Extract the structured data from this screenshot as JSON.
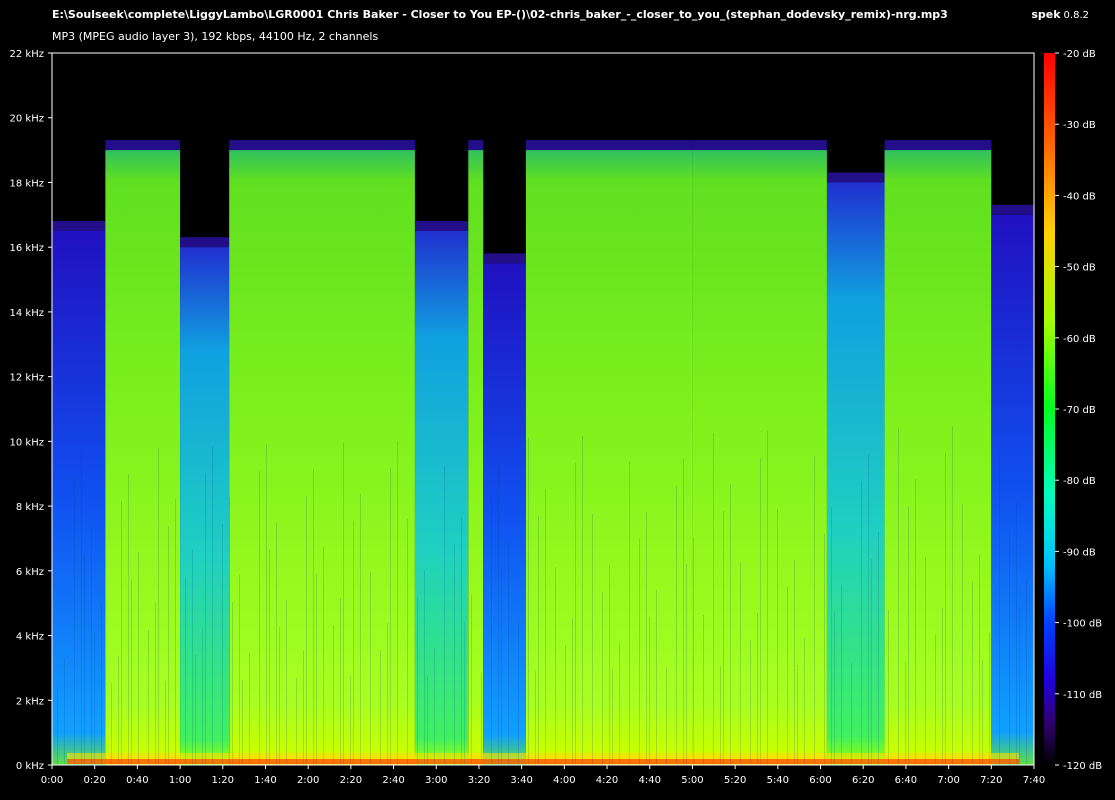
{
  "header": {
    "file_path": "E:\\Soulseek\\complete\\LiggyLambo\\LGR0001 Chris Baker - Closer to You EP-()\\02-chris_baker_-_closer_to_you_(stephan_dodevsky_remix)-nrg.mp3",
    "file_info": "MP3 (MPEG audio layer 3), 192 kbps, 44100 Hz, 2 channels",
    "app_name": "spek",
    "app_version": "0.8.2"
  },
  "frequency_axis": {
    "ticks": [
      "0 kHz",
      "2 kHz",
      "4 kHz",
      "6 kHz",
      "8 kHz",
      "10 kHz",
      "12 kHz",
      "14 kHz",
      "16 kHz",
      "18 kHz",
      "20 kHz",
      "22 kHz"
    ]
  },
  "time_axis": {
    "ticks": [
      "0:00",
      "0:20",
      "0:40",
      "1:00",
      "1:20",
      "1:40",
      "2:00",
      "2:20",
      "2:40",
      "3:00",
      "3:20",
      "3:40",
      "4:00",
      "4:20",
      "4:40",
      "5:00",
      "5:20",
      "5:40",
      "6:00",
      "6:20",
      "6:40",
      "7:00",
      "7:20",
      "7:40"
    ]
  },
  "db_scale": {
    "ticks": [
      "-20 dB",
      "-30 dB",
      "-40 dB",
      "-50 dB",
      "-60 dB",
      "-70 dB",
      "-80 dB",
      "-90 dB",
      "-100 dB",
      "-110 dB",
      "-120 dB"
    ],
    "colors": [
      "#ff0000",
      "#ff8000",
      "#ffff00",
      "#a0ff00",
      "#00ff00",
      "#00ffa0",
      "#00e0ff",
      "#0060ff",
      "#2000ff",
      "#400080",
      "#000000"
    ]
  },
  "spectrogram": {
    "sample_rate_khz": 22,
    "duration_s": 460,
    "segments": [
      {
        "t_start": 0,
        "t_end": 25,
        "cutoff_khz": 16.5,
        "level": "quiet"
      },
      {
        "t_start": 25,
        "t_end": 60,
        "cutoff_khz": 19,
        "level": "loud"
      },
      {
        "t_start": 60,
        "t_end": 83,
        "cutoff_khz": 16,
        "level": "mid"
      },
      {
        "t_start": 83,
        "t_end": 170,
        "cutoff_khz": 19,
        "level": "loud"
      },
      {
        "t_start": 170,
        "t_end": 195,
        "cutoff_khz": 16.5,
        "level": "mid"
      },
      {
        "t_start": 195,
        "t_end": 202,
        "cutoff_khz": 19,
        "level": "loud"
      },
      {
        "t_start": 202,
        "t_end": 222,
        "cutoff_khz": 15.5,
        "level": "quiet"
      },
      {
        "t_start": 222,
        "t_end": 300,
        "cutoff_khz": 19,
        "level": "loud"
      },
      {
        "t_start": 300,
        "t_end": 363,
        "cutoff_khz": 19,
        "level": "loud"
      },
      {
        "t_start": 363,
        "t_end": 390,
        "cutoff_khz": 18,
        "level": "mid"
      },
      {
        "t_start": 390,
        "t_end": 440,
        "cutoff_khz": 19,
        "level": "loud"
      },
      {
        "t_start": 440,
        "t_end": 460,
        "cutoff_khz": 17,
        "level": "quiet"
      }
    ]
  }
}
